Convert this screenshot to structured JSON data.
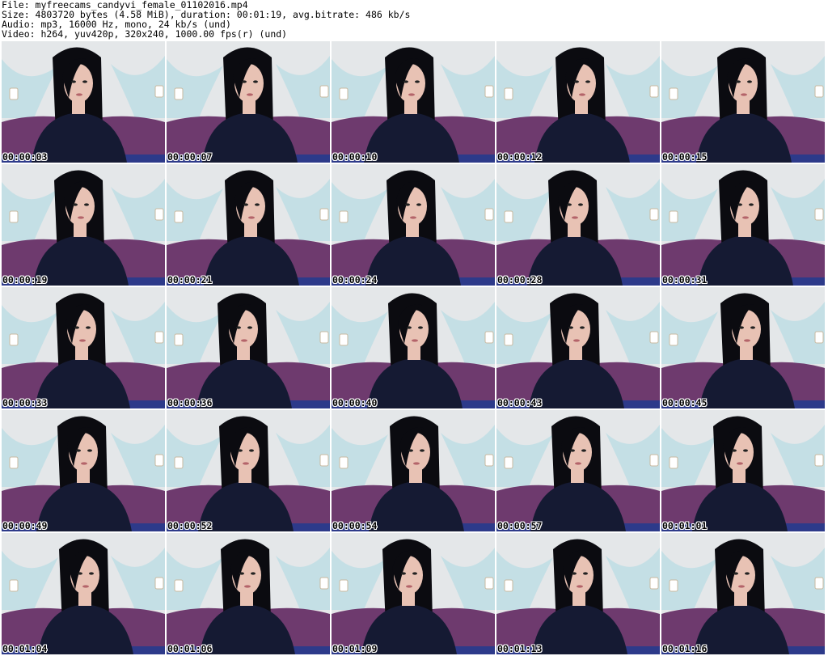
{
  "header": {
    "line1": "File: myfreecams_candyvi_female_01102016.mp4",
    "line2": "Size: 4803720 bytes (4.58 MiB), duration: 00:01:19, avg.bitrate: 486 kb/s",
    "line3": "Audio: mp3, 16000 Hz, mono, 24 kb/s (und)",
    "line4": "Video: h264, yuv420p, 320x240, 1000.00 fps(r) (und)"
  },
  "thumbnails": [
    {
      "time": "00:00:03"
    },
    {
      "time": "00:00:07"
    },
    {
      "time": "00:00:10"
    },
    {
      "time": "00:00:12"
    },
    {
      "time": "00:00:15"
    },
    {
      "time": "00:00:19"
    },
    {
      "time": "00:00:21"
    },
    {
      "time": "00:00:24"
    },
    {
      "time": "00:00:28"
    },
    {
      "time": "00:00:31"
    },
    {
      "time": "00:00:33"
    },
    {
      "time": "00:00:36"
    },
    {
      "time": "00:00:40"
    },
    {
      "time": "00:00:43"
    },
    {
      "time": "00:00:45"
    },
    {
      "time": "00:00:49"
    },
    {
      "time": "00:00:52"
    },
    {
      "time": "00:00:54"
    },
    {
      "time": "00:00:57"
    },
    {
      "time": "00:01:01"
    },
    {
      "time": "00:01:04"
    },
    {
      "time": "00:01:06"
    },
    {
      "time": "00:01:09"
    },
    {
      "time": "00:01:13"
    },
    {
      "time": "00:01:16"
    }
  ],
  "colors": {
    "wall": "#e4e7e9",
    "curtain": "#a9d9e2",
    "couch": "#6e3a6e",
    "shirt": "#151a33",
    "hair": "#0b0b10",
    "skin": "#e8c2b4"
  }
}
